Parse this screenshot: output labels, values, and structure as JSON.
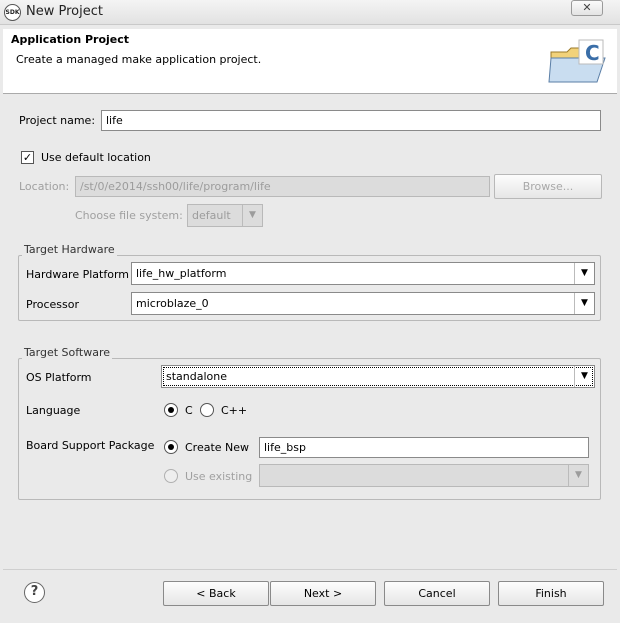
{
  "window": {
    "title": "New Project",
    "close_glyph": "✕",
    "app_icon_text": "SDK"
  },
  "header": {
    "title": "Application Project",
    "description": "Create a managed make application project.",
    "icon": "c-project-folder-icon"
  },
  "project_name": {
    "label": "Project name:",
    "value": "life"
  },
  "default_location": {
    "label": "Use default location",
    "checked": true
  },
  "location": {
    "label": "Location:",
    "value": "/st/0/e2014/ssh00/life/program/life",
    "browse_label": "Browse..."
  },
  "file_system": {
    "label": "Choose file system:",
    "value": "default"
  },
  "target_hardware": {
    "title": "Target Hardware",
    "hardware_platform": {
      "label": "Hardware Platform",
      "value": "life_hw_platform"
    },
    "processor": {
      "label": "Processor",
      "value": "microblaze_0"
    }
  },
  "target_software": {
    "title": "Target Software",
    "os_platform": {
      "label": "OS Platform",
      "value": "standalone"
    },
    "language": {
      "label": "Language",
      "options": [
        "C",
        "C++"
      ],
      "selected": "C"
    },
    "bsp": {
      "label": "Board Support Package",
      "create_new_label": "Create New",
      "create_new_value": "life_bsp",
      "use_existing_label": "Use existing",
      "use_existing_value": ""
    }
  },
  "footer": {
    "help_glyph": "?",
    "back_label": "< Back",
    "next_label": "Next >",
    "cancel_label": "Cancel",
    "finish_label": "Finish"
  },
  "icons": {
    "dropdown": "▼"
  }
}
